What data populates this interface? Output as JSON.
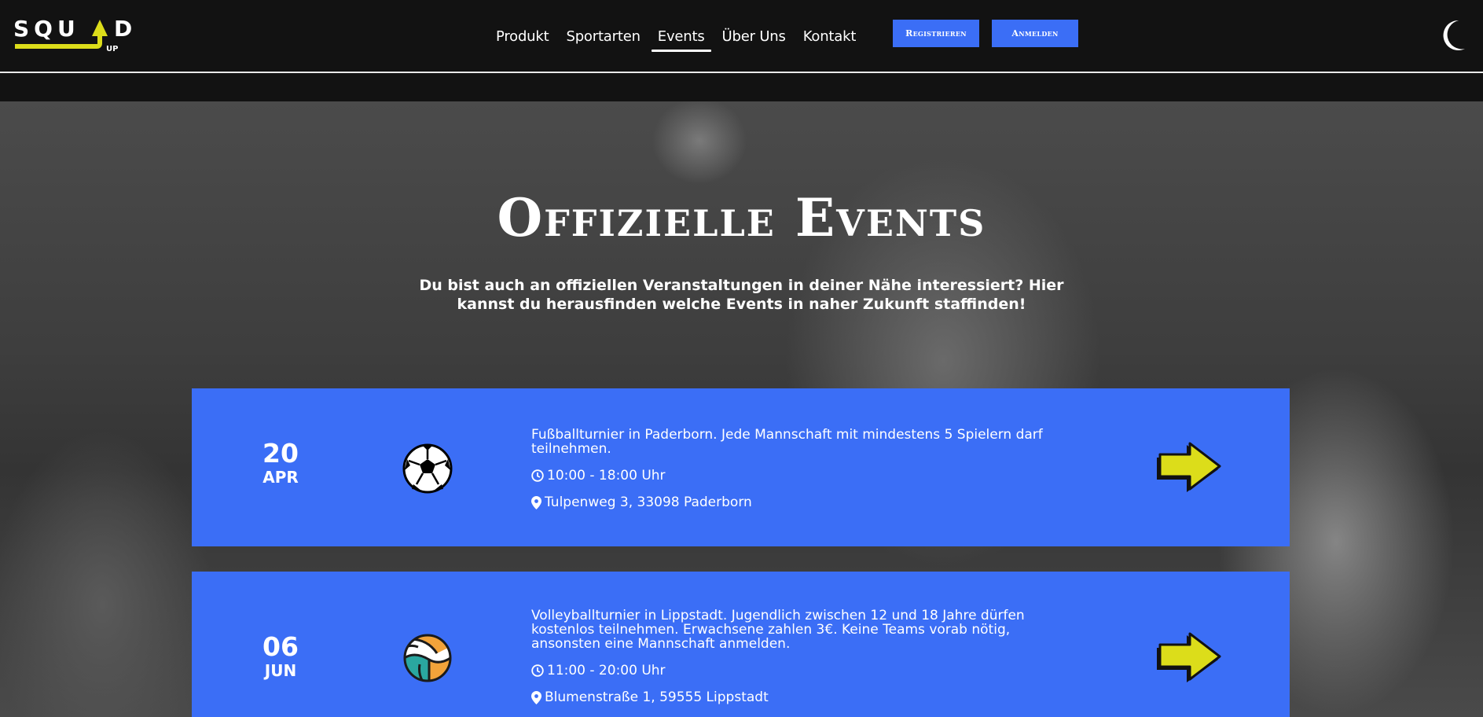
{
  "brand": {
    "logo_text": "SQUAD",
    "logo_sub": "UP",
    "accent": "#dcdd1a"
  },
  "nav": {
    "links": [
      "Produkt",
      "Sportarten",
      "Events",
      "Über Uns",
      "Kontakt"
    ],
    "active": "Events",
    "register_label": "Registrieren",
    "login_label": "Anmelden"
  },
  "theme_toggle_icon": "moon-icon",
  "colors": {
    "primary": "#3b6ef6",
    "nav_bg": "#121212"
  },
  "hero": {
    "title": "Offizielle Events",
    "subtitle": "Du bist auch an offiziellen Veranstaltungen in deiner Nähe interessiert? Hier kannst du herausfinden welche Events in naher Zukunft staffinden!"
  },
  "events": [
    {
      "day": "20",
      "month": "APR",
      "sport_icon": "soccer-ball-icon",
      "description": "Fußballturnier in Paderborn. Jede Mannschaft mit mindestens 5 Spielern darf teilnehmen.",
      "time": "10:00 - 18:00 Uhr",
      "location": "Tulpenweg 3, 33098 Paderborn"
    },
    {
      "day": "06",
      "month": "JUN",
      "sport_icon": "volleyball-icon",
      "description": "Volleyballturnier in Lippstadt. Jugendlich zwischen 12 und 18 Jahre dürfen kostenlos teilnehmen. Erwachsene zahlen 3€. Keine Teams vorab nötig, ansonsten eine Mannschaft anmelden.",
      "time": "11:00 - 20:00 Uhr",
      "location": "Blumenstraße 1, 59555 Lippstadt"
    }
  ]
}
